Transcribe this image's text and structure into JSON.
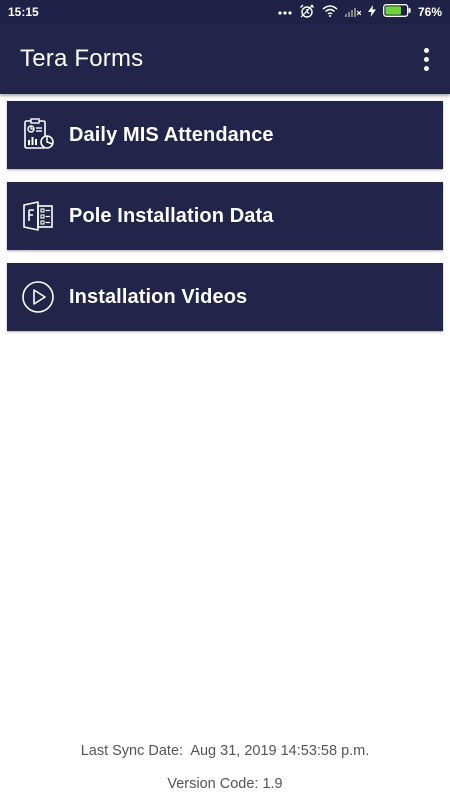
{
  "status_bar": {
    "time": "15:15",
    "battery_percent": "76%",
    "battery_level": 0.76,
    "icons": [
      "more-dots-icon",
      "alarm-icon",
      "wifi-icon",
      "signal-icon",
      "charging-icon",
      "battery-icon"
    ]
  },
  "app_bar": {
    "title": "Tera Forms",
    "overflow_icon": "more-vert-icon"
  },
  "menu": {
    "items": [
      {
        "label": "Daily MIS Attendance",
        "icon": "report-chart-icon"
      },
      {
        "label": "Pole Installation Data",
        "icon": "forms-icon"
      },
      {
        "label": "Installation Videos",
        "icon": "play-circle-icon"
      }
    ]
  },
  "footer": {
    "sync_label": "Last Sync Date:",
    "sync_value": "Aug 31, 2019 14:53:58 p.m.",
    "version_label": "Version Code:",
    "version_value": "1.9"
  },
  "colors": {
    "primary": "#222449",
    "status_bar": "#1f2147",
    "battery_fill": "#6fd43a",
    "footer_text": "#555555"
  }
}
